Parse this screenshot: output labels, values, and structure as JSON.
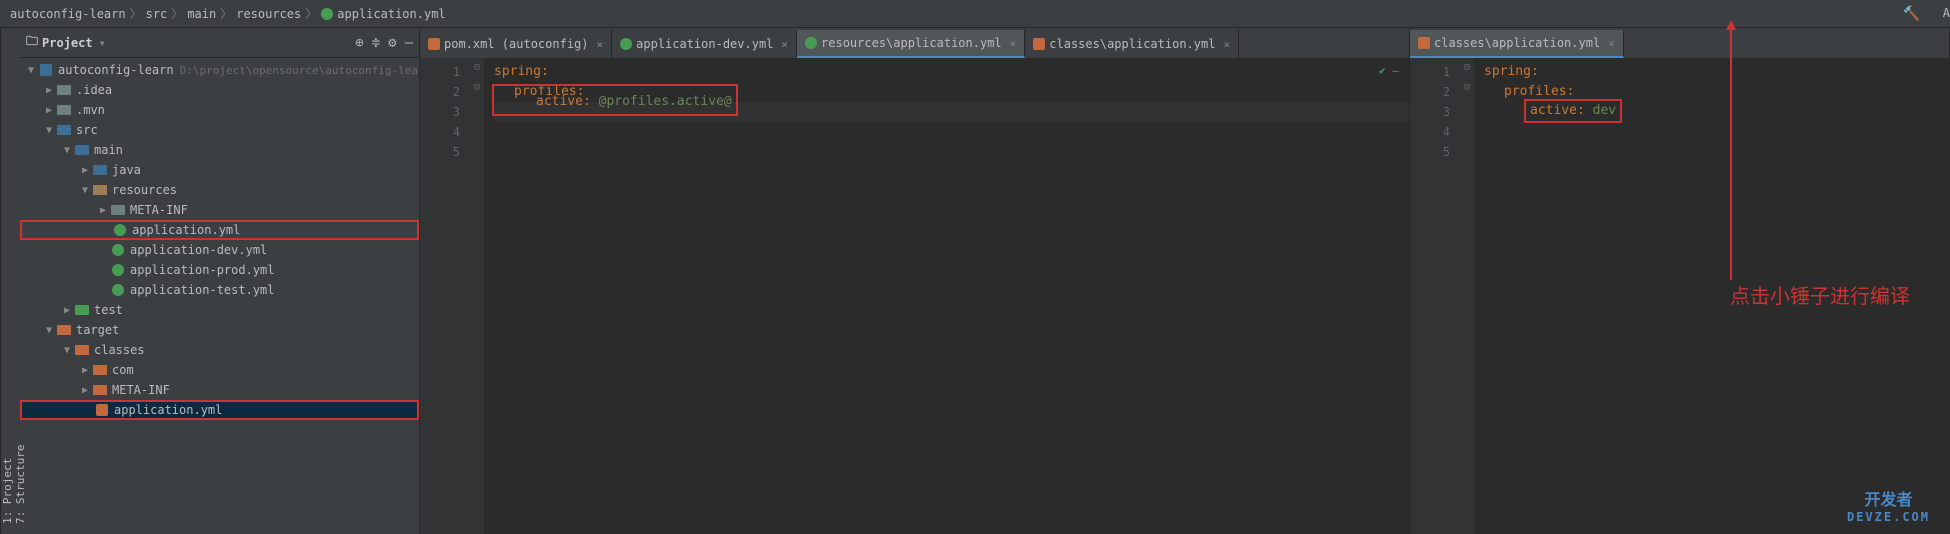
{
  "breadcrumb": [
    "autoconfig-learn",
    "src",
    "main",
    "resources",
    "application.yml"
  ],
  "runconfig": "A",
  "project_panel": {
    "title": "Project",
    "tree": [
      {
        "depth": 0,
        "arrow": "▼",
        "icon": "mod",
        "label": "autoconfig-learn",
        "path": "D:\\project\\opensource\\autoconfig-lea"
      },
      {
        "depth": 1,
        "arrow": "▶",
        "icon": "folder",
        "label": ".idea"
      },
      {
        "depth": 1,
        "arrow": "▶",
        "icon": "folder",
        "label": ".mvn"
      },
      {
        "depth": 1,
        "arrow": "▼",
        "icon": "folder-src",
        "label": "src"
      },
      {
        "depth": 2,
        "arrow": "▼",
        "icon": "folder-src",
        "label": "main"
      },
      {
        "depth": 3,
        "arrow": "▶",
        "icon": "folder-src",
        "label": "java"
      },
      {
        "depth": 3,
        "arrow": "▼",
        "icon": "folder-res",
        "label": "resources"
      },
      {
        "depth": 4,
        "arrow": "▶",
        "icon": "folder",
        "label": "META-INF"
      },
      {
        "depth": 4,
        "arrow": "",
        "icon": "yml",
        "label": "application.yml",
        "red": true
      },
      {
        "depth": 4,
        "arrow": "",
        "icon": "yml",
        "label": "application-dev.yml"
      },
      {
        "depth": 4,
        "arrow": "",
        "icon": "yml",
        "label": "application-prod.yml"
      },
      {
        "depth": 4,
        "arrow": "",
        "icon": "yml",
        "label": "application-test.yml"
      },
      {
        "depth": 2,
        "arrow": "▶",
        "icon": "folder-tst",
        "label": "test"
      },
      {
        "depth": 1,
        "arrow": "▼",
        "icon": "folder-tgt",
        "label": "target"
      },
      {
        "depth": 2,
        "arrow": "▼",
        "icon": "folder-tgt",
        "label": "classes"
      },
      {
        "depth": 3,
        "arrow": "▶",
        "icon": "folder-tgt",
        "label": "com"
      },
      {
        "depth": 3,
        "arrow": "▶",
        "icon": "folder-tgt",
        "label": "META-INF"
      },
      {
        "depth": 3,
        "arrow": "",
        "icon": "yml-cls",
        "label": "application.yml",
        "red": true,
        "selected": true
      }
    ]
  },
  "editor_left": {
    "tabs": [
      {
        "icon": "xml",
        "label": "pom.xml (autoconfig)",
        "active": false
      },
      {
        "icon": "yml",
        "label": "application-dev.yml",
        "active": false
      },
      {
        "icon": "yml",
        "label": "resources\\application.yml",
        "active": true
      },
      {
        "icon": "cls",
        "label": "classes\\application.yml",
        "active": false
      }
    ],
    "lines": [
      "1",
      "2",
      "3",
      "4",
      "5"
    ],
    "code": {
      "l1": "spring:",
      "l2": "profiles:",
      "l3k": "active: ",
      "l3v": "@profiles.active@"
    }
  },
  "editor_right": {
    "tabs": [
      {
        "icon": "cls",
        "label": "classes\\application.yml",
        "active": true
      }
    ],
    "lines": [
      "1",
      "2",
      "3",
      "4",
      "5"
    ],
    "code": {
      "l1": "spring:",
      "l2": "profiles:",
      "l3k": "active: ",
      "l3v": "dev"
    }
  },
  "annotation_text": "点击小锤子进行编译",
  "watermark": {
    "line1": "开发者",
    "line2": "DEVZE.COM"
  }
}
